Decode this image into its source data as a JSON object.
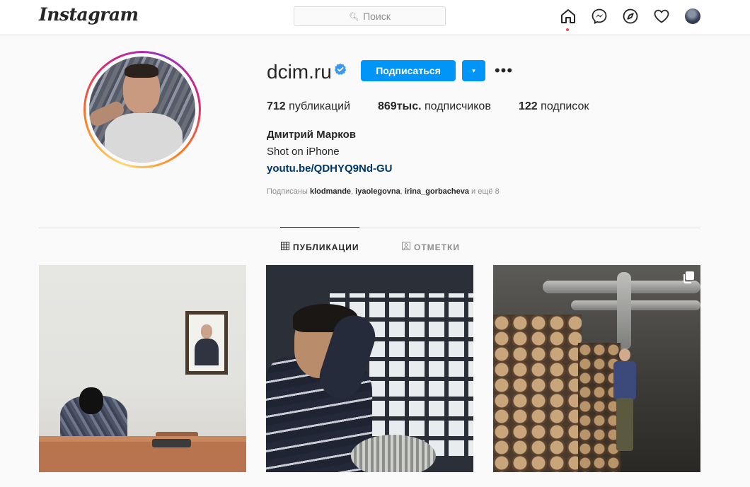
{
  "app": {
    "logo": "Instagram"
  },
  "search": {
    "placeholder": "Поиск",
    "icon": "search-icon"
  },
  "nav": {
    "icons": [
      "home-icon",
      "messenger-icon",
      "explore-icon",
      "heart-icon",
      "avatar"
    ],
    "accent_dot_color": "#ed4956"
  },
  "profile": {
    "username": "dcim.ru",
    "verified": true,
    "follow_label": "Подписаться",
    "dropdown_icon": "▾",
    "more_icon": "•••",
    "stats": [
      {
        "value": "712",
        "label": "публикаций"
      },
      {
        "value": "869тыс.",
        "label": "подписчиков"
      },
      {
        "value": "122",
        "label": "подписок"
      }
    ],
    "full_name": "Дмитрий Марков",
    "bio": "Shot on iPhone",
    "link": "youtu.be/QDHYQ9Nd-GU",
    "followed_by": {
      "prefix": "Подписаны",
      "users": [
        "klodmande",
        "iyaolegovna",
        "irina_gorbacheva"
      ],
      "suffix": "и ещё 8"
    }
  },
  "tabs": [
    {
      "label": "ПУБЛИКАЦИИ",
      "icon": "grid-icon",
      "active": true
    },
    {
      "label": "ОТМЕТКИ",
      "icon": "tagged-icon",
      "active": false
    }
  ],
  "colors": {
    "accent": "#0095f6",
    "link": "#00376b",
    "text": "#262626",
    "muted": "#8e8e8e"
  }
}
